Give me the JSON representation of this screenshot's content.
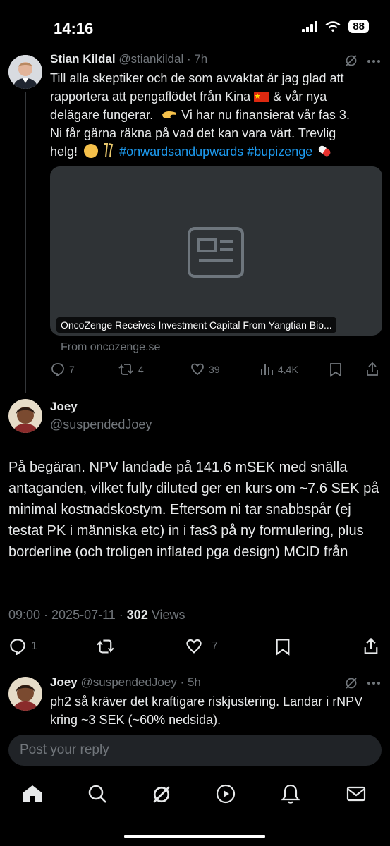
{
  "status_bar": {
    "time": "14:16",
    "battery": "88"
  },
  "tweet1": {
    "author_name": "Stian Kildal",
    "handle_time": "@stiankildal · 7h",
    "text_lines": [
      "Till alla skeptiker och de som avvaktat är jag glad att",
      "rapportera att pengaflödet från Kina",
      "& vår nya",
      "delägare fungerar.",
      "Vi har nu finansierat vår fas 3.",
      "Ni får gärna räkna på vad det kan vara värt. Trevlig",
      "helg!"
    ],
    "hashtags": "#onwardsandupwards #bupizenge",
    "card_title": "OncoZenge Receives Investment Capital From Yangtian Bio...",
    "card_source": "From oncozenge.se",
    "replies": "7",
    "retweets": "4",
    "likes": "39",
    "views": "4,4K"
  },
  "main_tweet": {
    "author_name": "Joey",
    "handle": "@suspendedJoey",
    "text": "På begäran. NPV landade på 141.6 mSEK med snälla antaganden, vilket fully diluted ger en kurs om ~7.6 SEK på minimal kostnadskostym. Eftersom ni tar snabbspår (ej testat PK i människa etc) in i fas3 på ny formulering, plus borderline (och troligen inflated pga design) MCID från",
    "timestamp": "09:00 · 2025-07-11 ·",
    "views_count": "302",
    "views_label": "Views",
    "replies": "1",
    "likes": "7"
  },
  "reply_tweet": {
    "author_name": "Joey",
    "handle_time": "@suspendedJoey · 5h",
    "text": "ph2 så kräver det kraftigare riskjustering. Landar i rNPV kring ~3 SEK (~60% nedsida)."
  },
  "reply_box": {
    "placeholder": "Post your reply"
  },
  "colors": {
    "accent": "#1d9bf0",
    "muted": "#71767b",
    "text": "#e7e9ea",
    "background": "#000000"
  },
  "tabbar": {
    "items": [
      "home-icon",
      "search-icon",
      "grok-icon",
      "video-icon",
      "bell-icon",
      "mail-icon"
    ]
  }
}
